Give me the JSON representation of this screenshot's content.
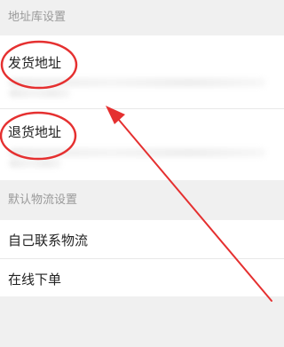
{
  "address_section": {
    "header": "地址库设置",
    "items": [
      {
        "label": "发货地址"
      },
      {
        "label": "退货地址"
      }
    ]
  },
  "logistics_section": {
    "header": "默认物流设置",
    "items": [
      {
        "label": "自己联系物流"
      },
      {
        "label": "在线下单"
      }
    ]
  },
  "annotation": {
    "color": "#e53030"
  }
}
